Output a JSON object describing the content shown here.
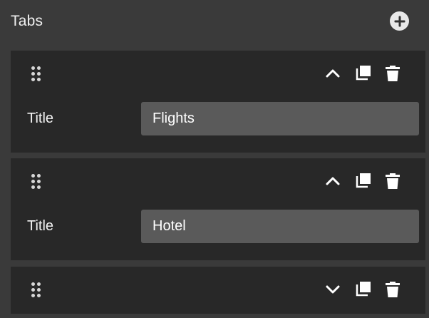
{
  "panel": {
    "title": "Tabs",
    "add_icon": "plus-circle-icon"
  },
  "colors": {
    "panel_bg": "#3a3a3a",
    "item_bg": "#282828",
    "input_bg": "#5a5a5a",
    "text": "#ffffff"
  },
  "items": [
    {
      "expanded": true,
      "toggle_icon": "chevron-up-icon",
      "field_label": "Title",
      "field_value": "Flights"
    },
    {
      "expanded": true,
      "toggle_icon": "chevron-up-icon",
      "field_label": "Title",
      "field_value": "Hotel"
    },
    {
      "expanded": false,
      "toggle_icon": "chevron-down-icon"
    }
  ]
}
